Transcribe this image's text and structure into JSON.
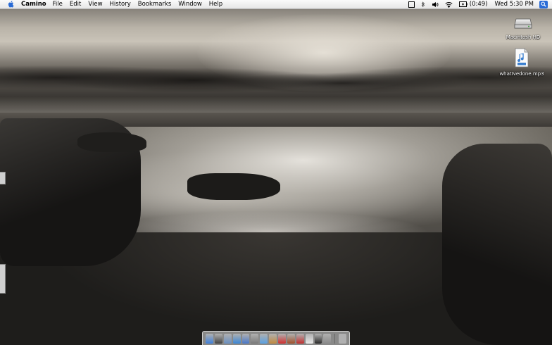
{
  "menubar": {
    "app_name": "Camino",
    "items": [
      {
        "label": "File"
      },
      {
        "label": "Edit"
      },
      {
        "label": "View"
      },
      {
        "label": "History"
      },
      {
        "label": "Bookmarks"
      },
      {
        "label": "Window"
      },
      {
        "label": "Help"
      }
    ],
    "status": {
      "battery_time": "(0:49)",
      "clock": "Wed 5:30 PM"
    }
  },
  "desktop": {
    "icons": [
      {
        "label": "Macintosh HD",
        "icon": "hard-drive-icon"
      },
      {
        "label": "whatIvedone.mp3",
        "icon": "mp3-file-icon"
      }
    ]
  },
  "dock": {
    "items": [
      {
        "icon": "finder-icon",
        "color": "#3f7fd8"
      },
      {
        "icon": "dashboard-icon",
        "color": "#444444"
      },
      {
        "icon": "mail-icon",
        "color": "#6a8fc0"
      },
      {
        "icon": "safari-icon",
        "color": "#3b86d6"
      },
      {
        "icon": "camino-icon",
        "color": "#4a78c8"
      },
      {
        "icon": "ichat-icon",
        "color": "#7a7a7a"
      },
      {
        "icon": "itunes-icon",
        "color": "#5aa0e0"
      },
      {
        "icon": "iphoto-icon",
        "color": "#c08a40"
      },
      {
        "icon": "ical-icon",
        "color": "#d03030"
      },
      {
        "icon": "address-book-icon",
        "color": "#a0522d"
      },
      {
        "icon": "preview-icon",
        "color": "#c03030"
      },
      {
        "icon": "textedit-icon",
        "color": "#e8e8e8"
      },
      {
        "icon": "terminal-icon",
        "color": "#2a2a2a"
      },
      {
        "icon": "system-preferences-icon",
        "color": "#8a8a8a"
      },
      {
        "icon": "trash-icon",
        "color": "#b0b0b0"
      }
    ]
  },
  "colors": {
    "menubar_bg": "#f0f0f0",
    "spotlight": "#2a6bd6"
  }
}
